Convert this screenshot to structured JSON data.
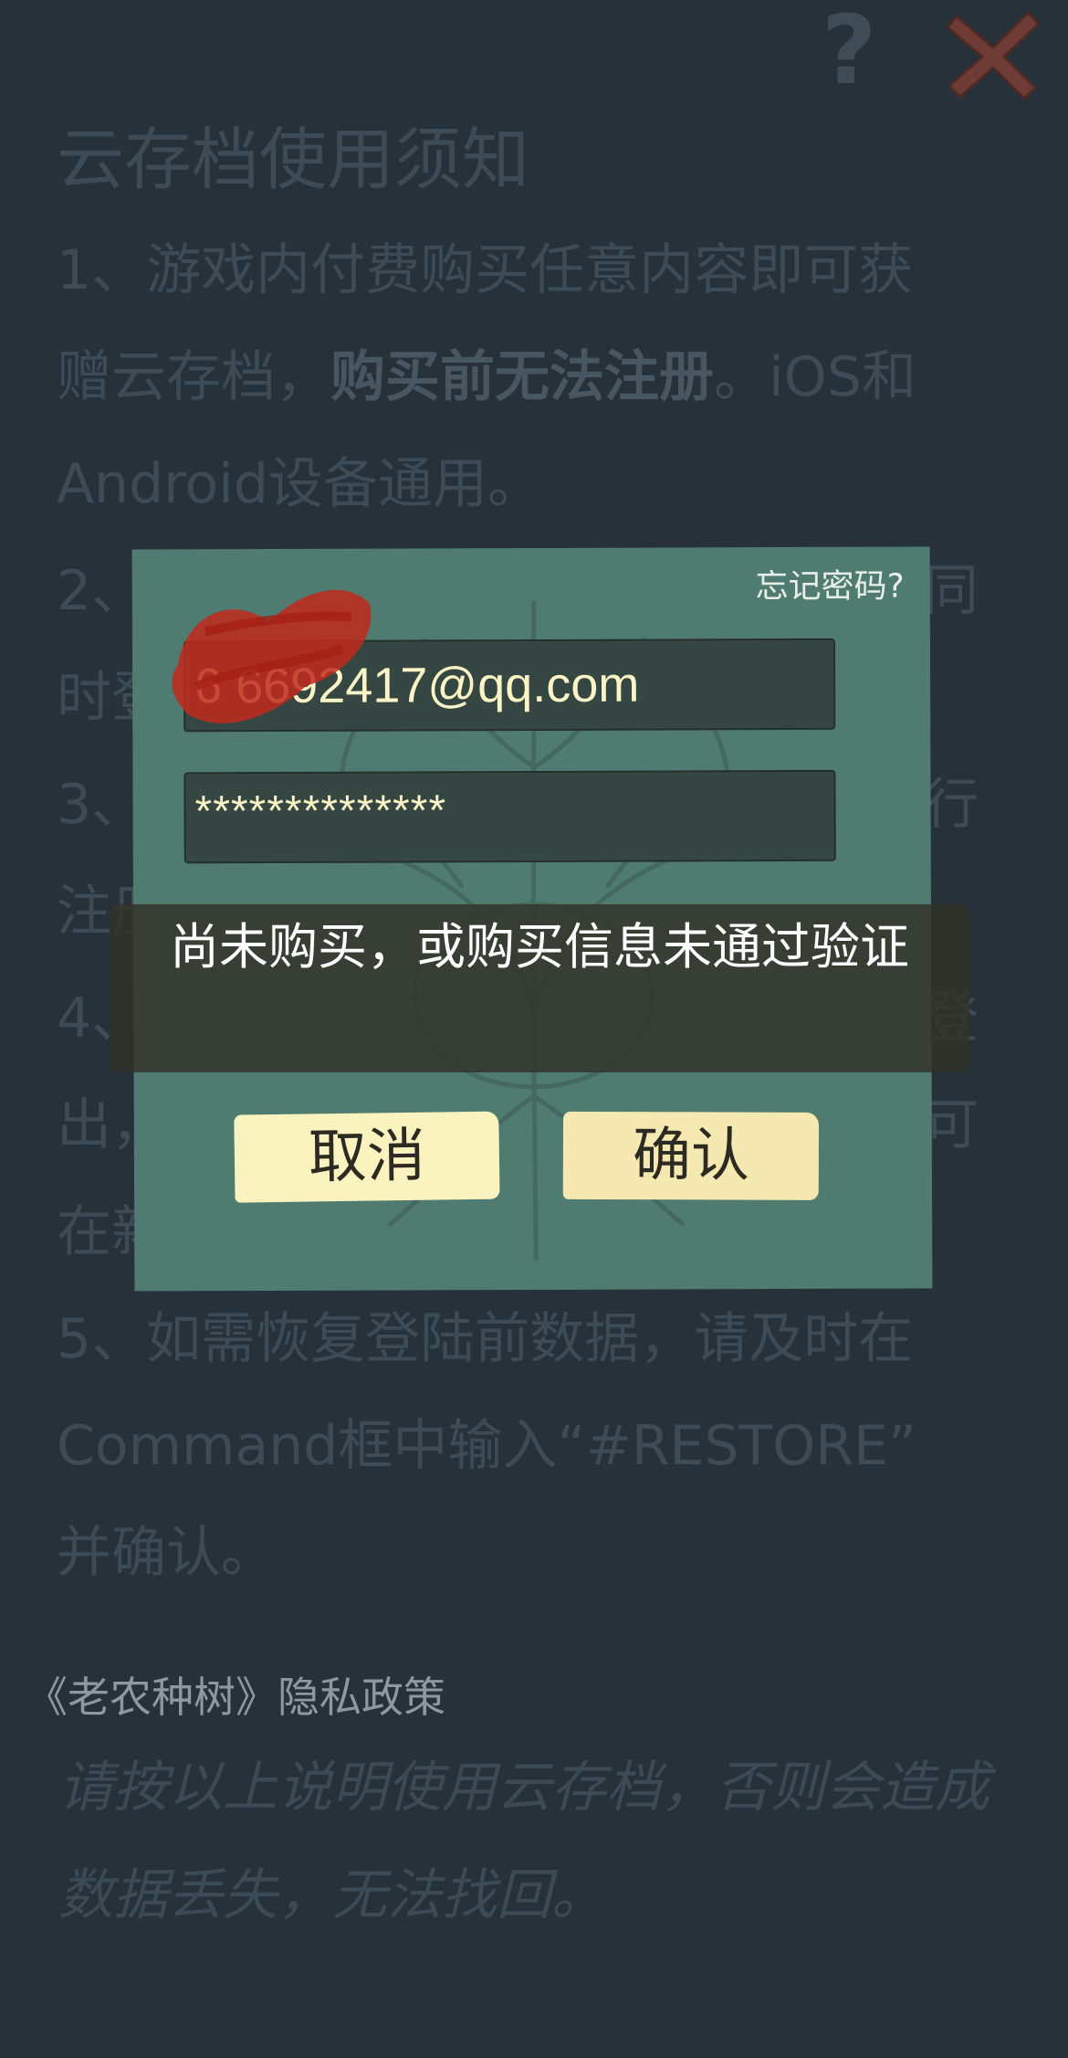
{
  "header": {
    "help_label": "?",
    "close_icon": "close-x-icon"
  },
  "notice": {
    "title": "云存档使用须知",
    "item1_line1": "1、游戏内付费购买任意内容即可获",
    "item1_line2_a": "赠云存档，",
    "item1_line2_bold": "购买前无法注册",
    "item1_line2_b": "。iOS和",
    "item1_line3": "Android设备通用。",
    "item2_prefix": "2、",
    "item2_suffix": "同",
    "item2_line2_prefix": "时登",
    "item3_prefix": "3、",
    "item3_suffix": "行",
    "item3_line2_prefix": "注册",
    "item4_prefix": "4、",
    "item4_suffix": "登",
    "item4_line2_prefix": "出，",
    "item4_line2_suffix": "可",
    "item4_line3_prefix": "在新",
    "item5_line1": "5、如需恢复登陆前数据，请及时在",
    "item5_line2": "Command框中输入“#RESTORE”",
    "item5_line3": "并确认。"
  },
  "privacy_link": "《老农种树》隐私政策",
  "warning": {
    "line1": "请按以上说明使用云存档，否则会造成",
    "line2": "数据丢失，无法找回。"
  },
  "dialog": {
    "forgot_password": "忘记密码?",
    "email_value": "6  6692417@qq.com",
    "password_value": "**************",
    "cancel_label": "取消",
    "confirm_label": "确认"
  },
  "toast": {
    "message": "尚未购买，或购买信息未通过验证"
  },
  "colors": {
    "background": "#26313a",
    "dialog": "#4f7b70",
    "button": "#fbf3bf",
    "field_text": "#fbf4c6",
    "close_icon": "#7a3b35"
  }
}
